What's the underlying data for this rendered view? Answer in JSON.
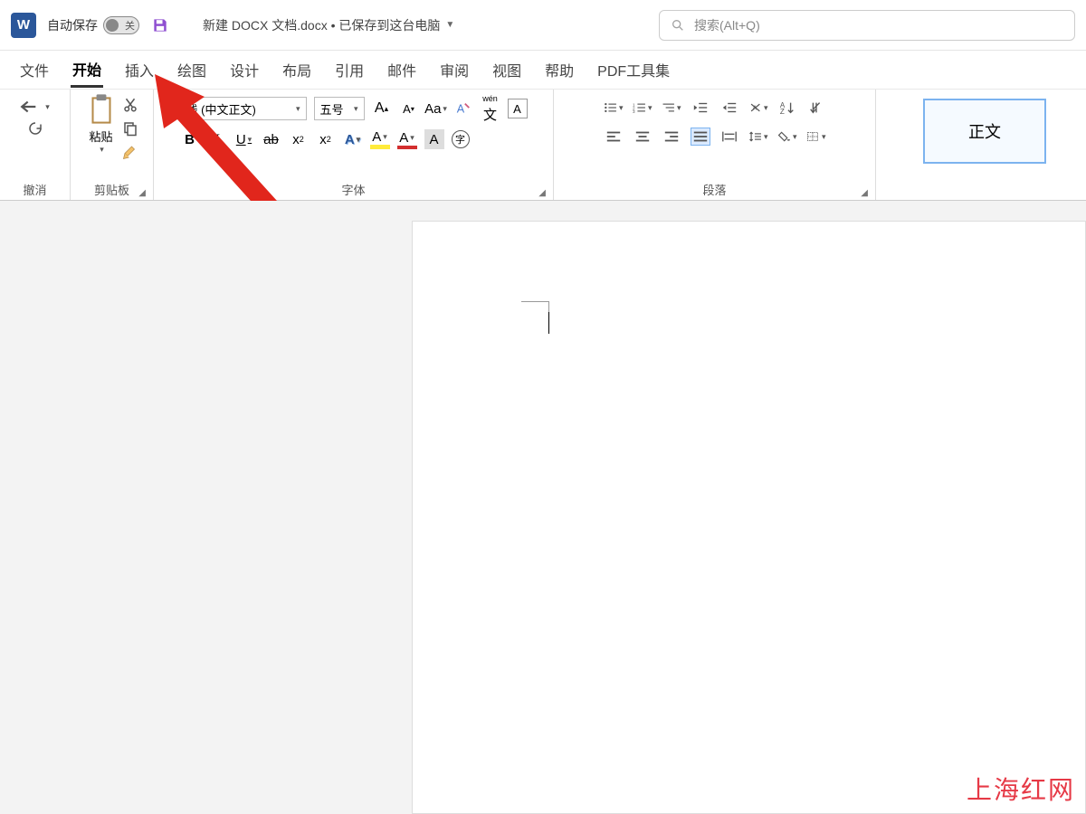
{
  "title_bar": {
    "autosave_label": "自动保存",
    "autosave_state": "关",
    "doc_title": "新建 DOCX 文档.docx • 已保存到这台电脑",
    "search_placeholder": "搜索(Alt+Q)"
  },
  "tabs": {
    "file": "文件",
    "home": "开始",
    "insert": "插入",
    "draw": "绘图",
    "design": "设计",
    "layout": "布局",
    "references": "引用",
    "mailings": "邮件",
    "review": "审阅",
    "view": "视图",
    "help": "帮助",
    "pdf": "PDF工具集"
  },
  "groups": {
    "undo": "撤消",
    "clipboard": "剪贴板",
    "font": "字体",
    "paragraph": "段落"
  },
  "clipboard": {
    "paste": "粘贴"
  },
  "font": {
    "font_name": "线 (中文正文)",
    "font_size": "五号",
    "phonetic": "wén",
    "phonetic_sub": "文",
    "char_border": "A",
    "change_case": "Aa",
    "bold": "B",
    "italic": "I",
    "underline": "U",
    "strike": "ab",
    "sub": "x",
    "sub2": "2",
    "sup": "x",
    "sup2": "2",
    "text_effects": "A",
    "highlight": "A",
    "font_color": "A",
    "shading": "A",
    "enclose": "字"
  },
  "styles": {
    "normal": "正文"
  },
  "watermark": "上海红网"
}
